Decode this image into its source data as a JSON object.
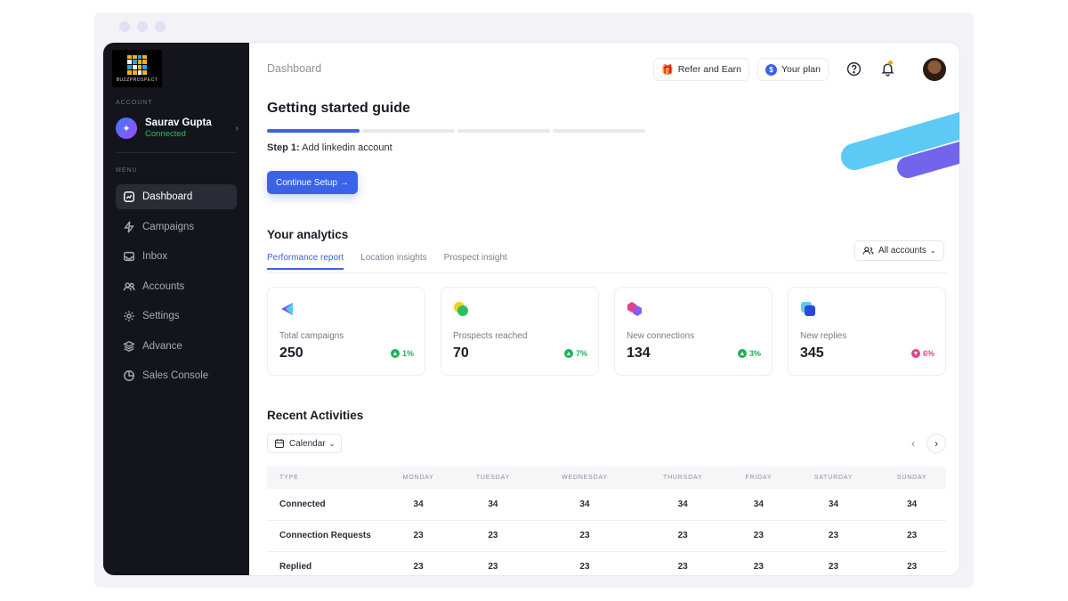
{
  "brand": {
    "logo_text": "BUZZPROSPECT",
    "accent": "#3a63ea"
  },
  "sidebar": {
    "account_section": "ACCOUNT",
    "account": {
      "name": "Saurav Gupta",
      "status": "Connected"
    },
    "menu_section": "MENU",
    "items": [
      {
        "label": "Dashboard",
        "icon": "dashboard-icon",
        "active": true
      },
      {
        "label": "Campaigns",
        "icon": "lightning-icon"
      },
      {
        "label": "Inbox",
        "icon": "inbox-icon"
      },
      {
        "label": "Accounts",
        "icon": "users-icon"
      },
      {
        "label": "Settings",
        "icon": "gear-icon"
      },
      {
        "label": "Advance",
        "icon": "layers-icon"
      },
      {
        "label": "Sales Console",
        "icon": "pie-icon"
      }
    ]
  },
  "header": {
    "breadcrumb": "Dashboard",
    "refer_label": "Refer and Earn",
    "plan_label": "Your plan"
  },
  "guide": {
    "title": "Getting started guide",
    "progress_steps_total": 4,
    "progress_steps_done": 1,
    "step_prefix": "Step 1:",
    "step_text": "Add linkedin account",
    "cta_label": "Continue Setup →"
  },
  "analytics": {
    "title": "Your analytics",
    "tabs": [
      "Performance report",
      "Location insights",
      "Prospect insight"
    ],
    "filter_label": "All accounts",
    "cards": [
      {
        "label": "Total campaigns",
        "value": "250",
        "change": "1%",
        "trend": "up"
      },
      {
        "label": "Prospects reached",
        "value": "70",
        "change": "7%",
        "trend": "up"
      },
      {
        "label": "New connections",
        "value": "134",
        "change": "3%",
        "trend": "up"
      },
      {
        "label": "New replies",
        "value": "345",
        "change": "6%",
        "trend": "down"
      }
    ]
  },
  "activities": {
    "title": "Recent Activities",
    "view_label": "Calendar",
    "columns": [
      "TYPE",
      "MONDAY",
      "TUESDAY",
      "WEDNESDAY",
      "THURSDAY",
      "FRIDAY",
      "SATURDAY",
      "SUNDAY"
    ],
    "rows": [
      {
        "type": "Connected",
        "values": [
          "34",
          "34",
          "34",
          "34",
          "34",
          "34",
          "34"
        ]
      },
      {
        "type": "Connection Requests",
        "values": [
          "23",
          "23",
          "23",
          "23",
          "23",
          "23",
          "23"
        ]
      },
      {
        "type": "Replied",
        "values": [
          "23",
          "23",
          "23",
          "23",
          "23",
          "23",
          "23"
        ]
      }
    ]
  }
}
